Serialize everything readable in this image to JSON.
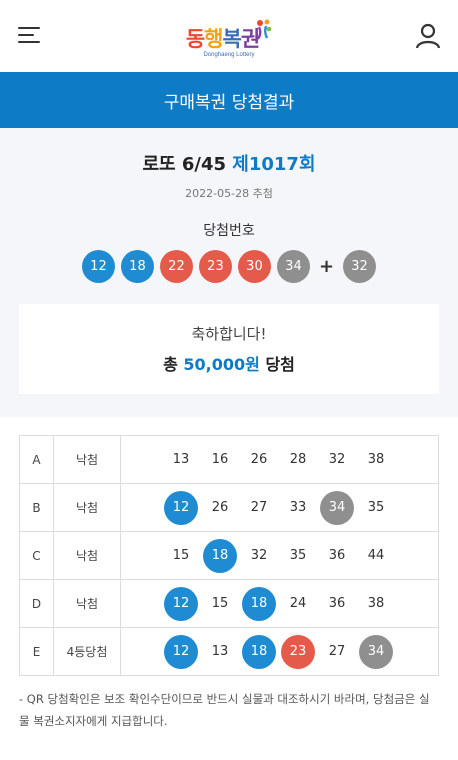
{
  "header": {
    "logo_text": "동행복권",
    "logo_subtitle": "Donghaeng Lottery"
  },
  "banner": {
    "title": "구매복권 당첨결과"
  },
  "draw": {
    "game_name": "로또 6/45",
    "round": "제1017회",
    "date": "2022-05-28 추첨",
    "win_label": "당첨번호",
    "plus": "+",
    "numbers": [
      {
        "n": "12",
        "color": "blue"
      },
      {
        "n": "18",
        "color": "blue"
      },
      {
        "n": "22",
        "color": "red"
      },
      {
        "n": "23",
        "color": "red"
      },
      {
        "n": "30",
        "color": "red"
      },
      {
        "n": "34",
        "color": "gray"
      }
    ],
    "bonus": {
      "n": "32",
      "color": "gray"
    }
  },
  "congrats": {
    "message": "축하합니다!",
    "prize_prefix": "총",
    "prize_amount": "50,000원",
    "prize_suffix": "당첨"
  },
  "games": [
    {
      "label": "A",
      "result": "낙첨",
      "numbers": [
        {
          "n": "13",
          "c": ""
        },
        {
          "n": "16",
          "c": ""
        },
        {
          "n": "26",
          "c": ""
        },
        {
          "n": "28",
          "c": ""
        },
        {
          "n": "32",
          "c": ""
        },
        {
          "n": "38",
          "c": ""
        }
      ]
    },
    {
      "label": "B",
      "result": "낙첨",
      "numbers": [
        {
          "n": "12",
          "c": "blue"
        },
        {
          "n": "26",
          "c": ""
        },
        {
          "n": "27",
          "c": ""
        },
        {
          "n": "33",
          "c": ""
        },
        {
          "n": "34",
          "c": "gray"
        },
        {
          "n": "35",
          "c": ""
        }
      ]
    },
    {
      "label": "C",
      "result": "낙첨",
      "numbers": [
        {
          "n": "15",
          "c": ""
        },
        {
          "n": "18",
          "c": "blue"
        },
        {
          "n": "32",
          "c": ""
        },
        {
          "n": "35",
          "c": ""
        },
        {
          "n": "36",
          "c": ""
        },
        {
          "n": "44",
          "c": ""
        }
      ]
    },
    {
      "label": "D",
      "result": "낙첨",
      "numbers": [
        {
          "n": "12",
          "c": "blue"
        },
        {
          "n": "15",
          "c": ""
        },
        {
          "n": "18",
          "c": "blue"
        },
        {
          "n": "24",
          "c": ""
        },
        {
          "n": "36",
          "c": ""
        },
        {
          "n": "38",
          "c": ""
        }
      ]
    },
    {
      "label": "E",
      "result": "4등당첨",
      "numbers": [
        {
          "n": "12",
          "c": "blue"
        },
        {
          "n": "13",
          "c": ""
        },
        {
          "n": "18",
          "c": "blue"
        },
        {
          "n": "23",
          "c": "red"
        },
        {
          "n": "27",
          "c": ""
        },
        {
          "n": "34",
          "c": "gray"
        }
      ]
    }
  ],
  "notice": "- QR 당첨확인은 보조 확인수단이므로 반드시 실물과 대조하시기 바라며, 당첨금은 실물 복권소지자에게 지급합니다.",
  "colors": {
    "blue": "#1e8bd3",
    "red": "#e45b4b",
    "gray": "#8f8f8f",
    "accent": "#0d7bc6"
  }
}
